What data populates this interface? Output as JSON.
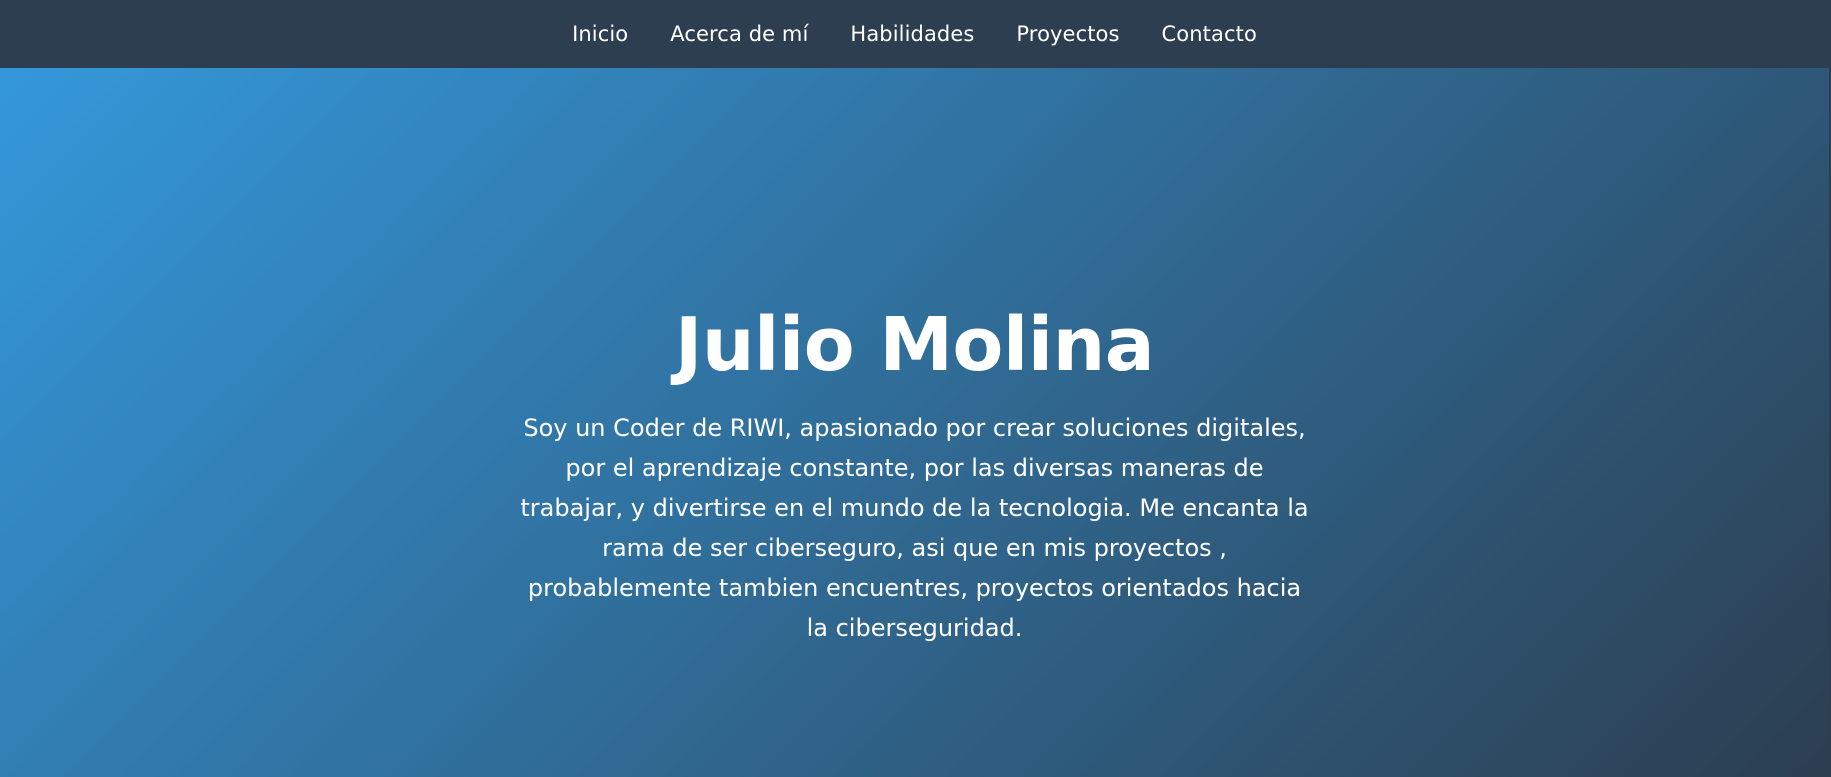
{
  "nav": {
    "items": [
      {
        "label": "Inicio"
      },
      {
        "label": "Acerca de mí"
      },
      {
        "label": "Habilidades"
      },
      {
        "label": "Proyectos"
      },
      {
        "label": "Contacto"
      }
    ]
  },
  "hero": {
    "title": "Julio Molina",
    "description": "Soy un Coder de RIWI, apasionado por crear soluciones digitales, por el aprendizaje constante, por las diversas maneras de trabajar, y divertirse en el mundo de la tecnologia. Me encanta la rama de ser ciberseguro, asi que en mis proyectos , probablemente tambien encuentres, proyectos orientados hacia la ciberseguridad."
  },
  "colors": {
    "navbar": "#2c3e50",
    "gradient_start": "#3498db",
    "gradient_end": "#2c3e50",
    "text": "#ffffff"
  }
}
